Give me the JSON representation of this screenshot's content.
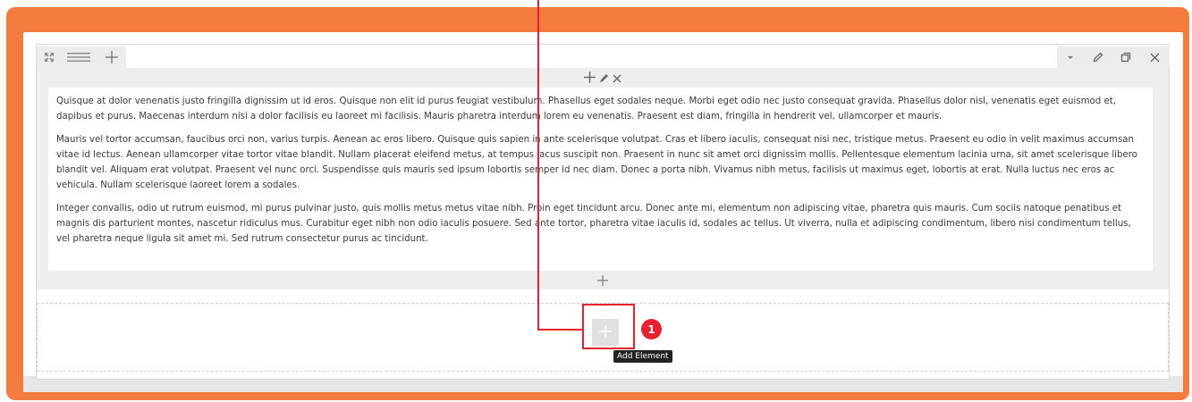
{
  "colors": {
    "frame": "#f47b3e",
    "annotation": "#e8212f",
    "toolbar_bg": "#ececec",
    "column_bg": "#eeeeee"
  },
  "row_toolbar": {
    "left_icons": [
      "expand-icon",
      "menu-lines-icon",
      "plus-icon"
    ],
    "right_icons": [
      "chevron-down-icon",
      "pencil-icon",
      "copy-icon",
      "close-icon"
    ]
  },
  "column": {
    "control_icons": [
      "plus-icon",
      "pencil-icon",
      "close-icon"
    ],
    "add_icon": "plus-icon"
  },
  "text_block": {
    "paragraphs": [
      "Quisque at dolor venenatis justo fringilla dignissim ut id eros. Quisque non elit id purus feugiat vestibulum. Phasellus eget sodales neque. Morbi eget odio nec justo consequat gravida. Phasellus dolor nisl, venenatis eget euismod et, dapibus et purus. Maecenas interdum nisi a dolor facilisis eu laoreet mi facilisis. Mauris pharetra interdum lorem eu venenatis. Praesent est diam, fringilla in hendrerit vel, ullamcorper et mauris.",
      "Mauris vel tortor accumsan, faucibus orci non, varius turpis. Aenean ac eros libero. Quisque quis sapien in ante scelerisque volutpat. Cras et libero iaculis, consequat nisi nec, tristique metus. Praesent eu odio in velit maximus accumsan vitae id lectus. Aenean ullamcorper vitae tortor vitae blandit. Nullam placerat eleifend metus, at tempus lacus suscipit non. Praesent in nunc sit amet orci dignissim mollis. Pellentesque elementum lacinia urna, sit amet scelerisque libero blandit vel. Aliquam erat volutpat. Praesent vel nunc orci. Suspendisse quis mauris sed ipsum lobortis semper id nec diam. Donec a porta nibh. Vivamus nibh metus, facilisis ut maximus eget, lobortis at erat. Nulla luctus nec eros ac vehicula. Nullam scelerisque laoreet lorem a sodales.",
      "Integer convallis, odio ut rutrum euismod, mi purus pulvinar justo, quis mollis metus metus vitae nibh. Proin eget tincidunt arcu. Donec ante mi, elementum non adipiscing vitae, pharetra quis mauris. Cum sociis natoque penatibus et magnis dis parturient montes, nascetur ridiculus mus. Curabitur eget nibh non odio iaculis posuere. Sed ante tortor, pharetra vitae iaculis id, sodales ac tellus. Ut viverra, nulla et adipiscing condimentum, libero nisi condimentum tellus, vel pharetra neque ligula sit amet mi. Sed rutrum consectetur purus ac tincidunt."
    ]
  },
  "add_element": {
    "tooltip": "Add Element",
    "callout_number": "1"
  }
}
